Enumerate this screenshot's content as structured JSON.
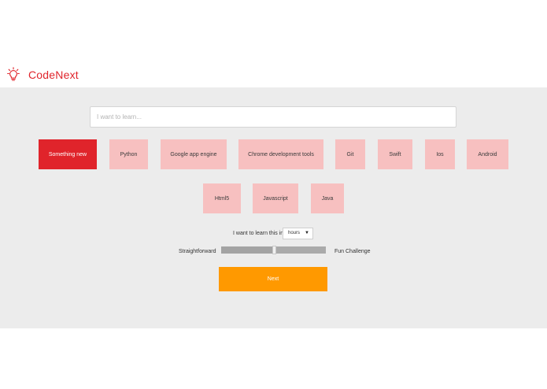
{
  "app": {
    "brand": "CodeNext",
    "logo_icon": "lightbulb-icon",
    "accent_color": "#e0242b"
  },
  "search": {
    "placeholder": "I want to learn...",
    "value": ""
  },
  "tags": [
    {
      "label": "Something new",
      "selected": true
    },
    {
      "label": "Python",
      "selected": false
    },
    {
      "label": "Google app engine",
      "selected": false
    },
    {
      "label": "Chrome development tools",
      "selected": false
    },
    {
      "label": "Git",
      "selected": false
    },
    {
      "label": "Swift",
      "selected": false
    },
    {
      "label": "Ios",
      "selected": false
    },
    {
      "label": "Android",
      "selected": false
    },
    {
      "label": "Html5",
      "selected": false
    },
    {
      "label": "Javascript",
      "selected": false
    },
    {
      "label": "Java",
      "selected": false
    }
  ],
  "time_unit": {
    "label": "I want to learn this in:",
    "selected": "hours"
  },
  "difficulty": {
    "left_label": "Straightforward",
    "right_label": "Fun Challenge",
    "value_fraction": 0.5
  },
  "next": {
    "label": "Next",
    "color": "#ff9900"
  }
}
